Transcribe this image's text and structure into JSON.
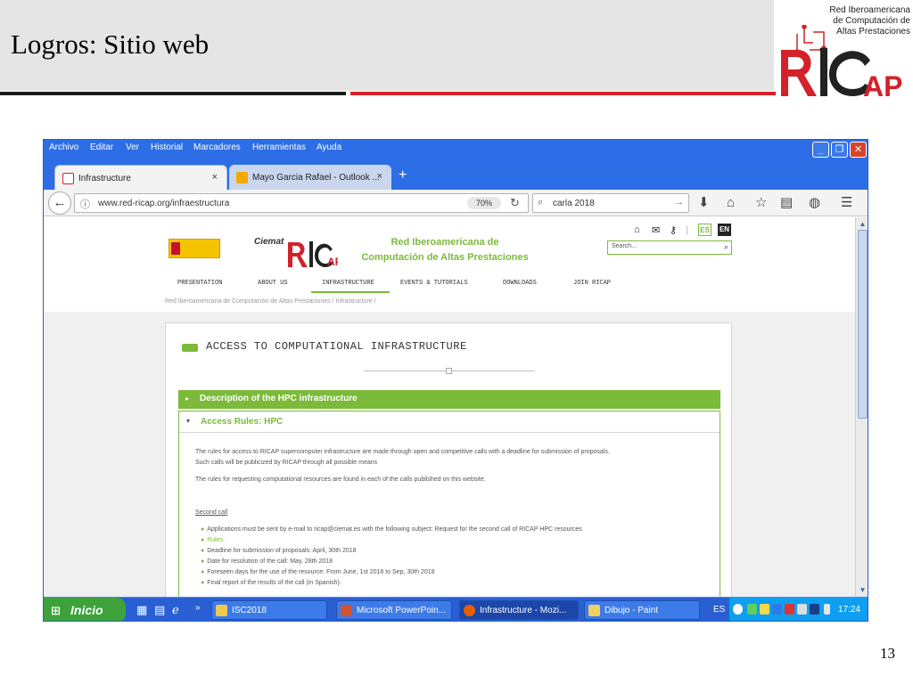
{
  "slide": {
    "title": "Logros: Sitio web",
    "page_number": "13",
    "logo": {
      "tagline_lines": [
        "Red Iberoamericana",
        "de Computación de",
        "Altas Prestaciones"
      ],
      "wordmark": "RICAP"
    },
    "colors": {
      "accent_red": "#d3222a",
      "header_gray": "#e5e5e5"
    }
  },
  "browser": {
    "menu": [
      "Archivo",
      "Editar",
      "Ver",
      "Historial",
      "Marcadores",
      "Herramientas",
      "Ayuda"
    ],
    "tabs": [
      {
        "label": "Infrastructure",
        "close": "×"
      },
      {
        "label": "Mayo Garcia Rafael - Outlook ...",
        "close": "×"
      }
    ],
    "new_tab": "+",
    "url": "www.red-ricap.org/infraestructura",
    "zoom": "70%",
    "search_value": "carla 2018"
  },
  "site": {
    "name_lines": [
      "Red Iberoamericana de",
      "Computación de Altas Prestaciones"
    ],
    "lang": [
      "ES",
      "EN"
    ],
    "search_placeholder": "Search...",
    "nav": [
      "PRESENTATION",
      "ABOUT US",
      "INFRASTRUCTURE",
      "EVENTS & TUTORIALS",
      "DOWNLOADS",
      "JOIN RICAP"
    ],
    "breadcrumb": "Red Iberoamericana de Computación de Altas Prestaciones  /  Infrastructure  /",
    "logos": {
      "ciemat": "Ciemat"
    },
    "colors": {
      "green": "#7cba3a"
    }
  },
  "content": {
    "section_title": "ACCESS TO COMPUTATIONAL INFRASTRUCTURE",
    "accordion_closed": "Description of the HPC infrastructure",
    "accordion_open": "Access Rules: HPC",
    "para1_line1": "The rules for access to RICAP supercomputer infrastructure are made through open and competitive calls with a deadline for submission of proposals.",
    "para1_line2": "Such calls will be publicized by RICAP through all possible means",
    "para2": "The rules for requesting computational resources are found in each of the calls published on this website.",
    "second_call": "Second call",
    "bullets": [
      "Applications must be sent by e-mail to ricap@ciemat.es with the following subject: Request for the second call of RICAP HPC resources",
      "Rules.",
      "Deadline for submission of proposals: April, 30th 2018",
      "Date for resolution of the call: May, 28th 2018",
      "Foreseen days for the use of the resource: From June, 1st 2018 to Sep, 30th 2018",
      "Final report of the results of the call (in Spanish)."
    ]
  },
  "taskbar": {
    "start": "Inicio",
    "quick_more": "»",
    "tasks": [
      "ISC2018",
      "Microsoft PowerPoin...",
      "Infrastructure - Mozi...",
      "Dibujo - Paint"
    ],
    "tray_lang": "ES",
    "clock": "17:24"
  }
}
